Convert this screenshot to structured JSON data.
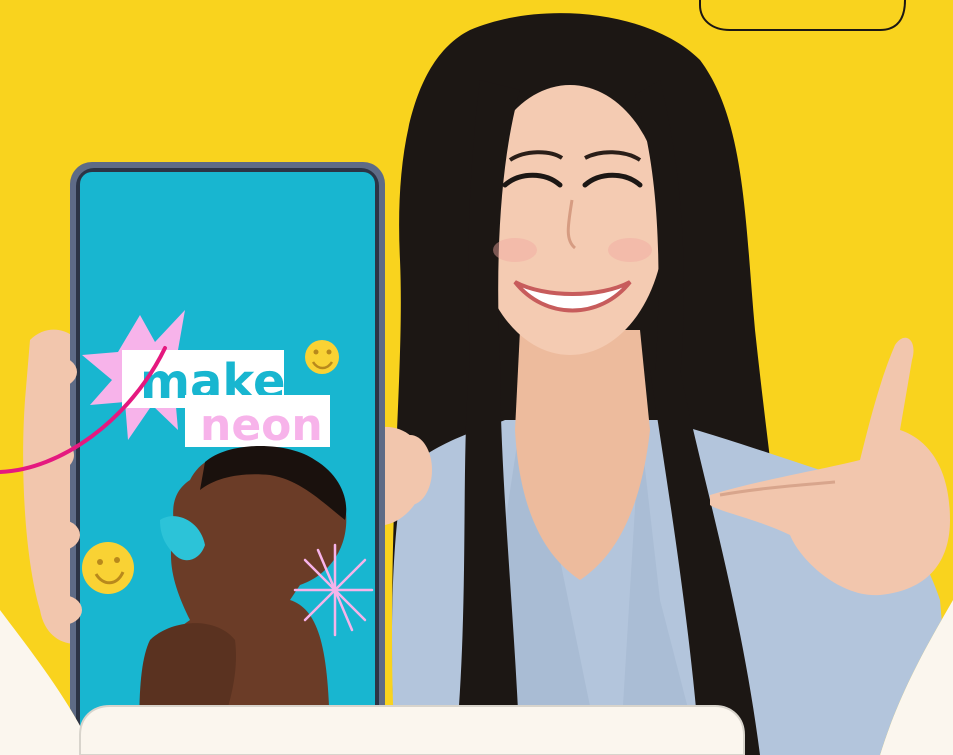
{
  "phone": {
    "headline_line1": "make",
    "headline_line2": "neon"
  },
  "colors": {
    "background_yellow": "#f6cf17",
    "page_cream": "#fbf6ee",
    "screen_cyan": "#18b6d0",
    "starburst_pink": "#f7b3ea",
    "accent_magenta": "#e5197f",
    "neon_text_pink": "#f7b3ea",
    "hair_black": "#1c1714",
    "shirt_blue": "#b3c5dc",
    "skin_tone": "#f2c6ad",
    "smiley_yellow": "#f9d234",
    "card_border": "#d8d4cc"
  },
  "icons": [
    "smiley-icon",
    "starburst-icon",
    "sparkle-burst-icon"
  ]
}
